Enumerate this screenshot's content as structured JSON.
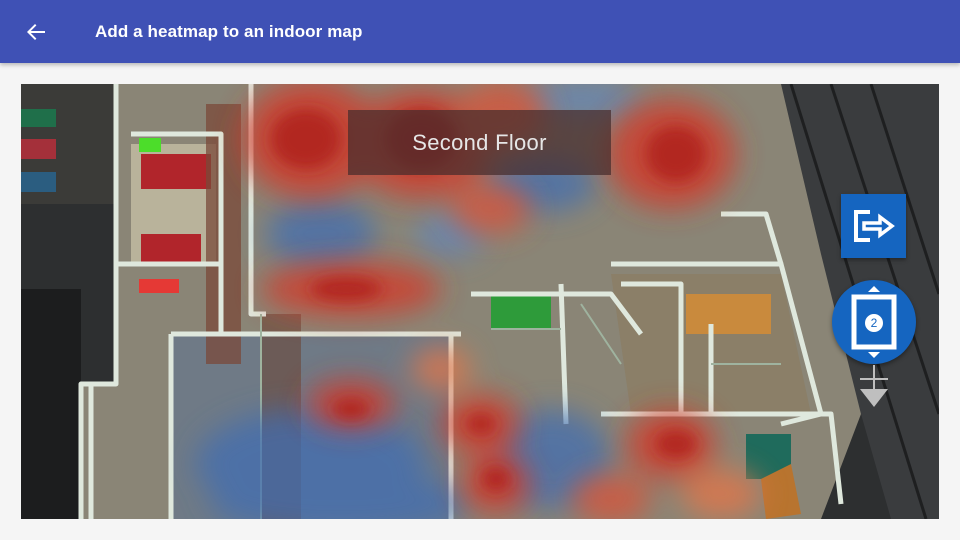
{
  "app": {
    "title": "Add a heatmap to an indoor map",
    "back_icon": "arrow-left-icon"
  },
  "map": {
    "floor_label": "Second Floor",
    "current_floor": "2",
    "controls": {
      "exit_icon": "exit-indoor-icon",
      "floor_picker_icon": "elevator-floor-icon",
      "down_icon": "floor-down-icon"
    }
  },
  "colors": {
    "app_bar": "#3f51b5",
    "control_blue": "#1565c0",
    "heat_hot": "#c62828",
    "heat_cold": "#3f6db3"
  }
}
